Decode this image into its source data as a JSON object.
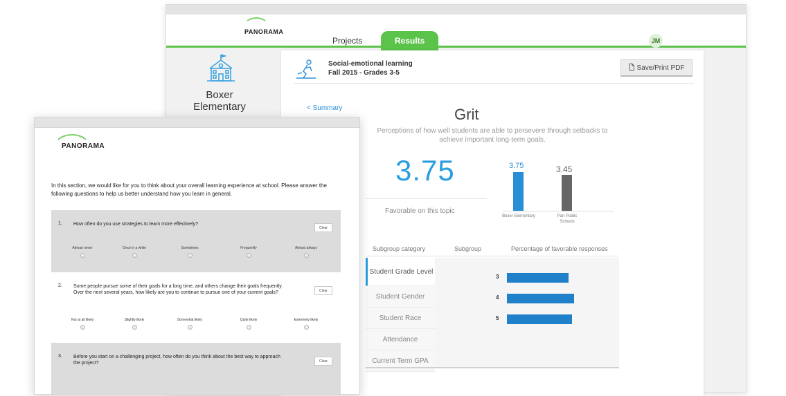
{
  "dashboard": {
    "logo": "PANORAMA",
    "nav": {
      "projects": "Projects",
      "results": "Results"
    },
    "user_initials": "JM",
    "school": {
      "line1": "Boxer",
      "line2": "Elementary"
    },
    "topic": {
      "title": "Social-emotional learning",
      "subtitle": "Fall 2015 - Grades 3-5"
    },
    "save_button": "Save/Print PDF",
    "summary_link": "< Summary",
    "measure": {
      "title": "Grit",
      "description": "Perceptions of how well students are able to persevere through setbacks to achieve important long-term goals.",
      "score": "3.75",
      "score_label": "Favorable on this topic"
    },
    "comparison": [
      {
        "label": "3.75",
        "caption": "Boxer Elementary",
        "value": 3.75,
        "color": "#2a8ed6"
      },
      {
        "label": "3.45",
        "caption": "Pan Public Schools",
        "value": 3.45,
        "color": "#666666"
      }
    ],
    "subgroup_table": {
      "headers": {
        "category": "Subgroup category",
        "subgroup": "Subgroup",
        "percentage": "Percentage of favorable responses"
      },
      "categories": [
        "Student Grade Level",
        "Student Gender",
        "Student Race",
        "Attendance",
        "Current Term GPA"
      ],
      "active_category": "Student Grade Level",
      "rows": [
        {
          "label": "3",
          "percent": 0.82
        },
        {
          "label": "4",
          "percent": 0.9
        },
        {
          "label": "5",
          "percent": 0.87
        }
      ],
      "bar_color": "#2080c9"
    }
  },
  "survey": {
    "logo": "PANORAMA",
    "intro": "In this section, we would like for you to think about your overall learning experience at school. Please answer the following questions to help us better understand how you learn in general.",
    "clear_label": "Clear",
    "questions": [
      {
        "number": "1.",
        "text": "How often do you use strategies to learn more effectively?",
        "options": [
          "Almost never",
          "Once in a while",
          "Sometimes",
          "Frequently",
          "Almost always"
        ]
      },
      {
        "number": "2.",
        "text": "Some people pursue some of their goals for a long time, and others change their goals frequently.  Over the next several years, how likely are you to continue to pursue one of your current goals?",
        "options": [
          "Not at all likely",
          "Slightly likely",
          "Somewhat likely",
          "Quite likely",
          "Extremely likely"
        ]
      },
      {
        "number": "3.",
        "text": "Before you start on a challenging project, how often do you think about the best way to approach the project?",
        "options": []
      }
    ]
  }
}
